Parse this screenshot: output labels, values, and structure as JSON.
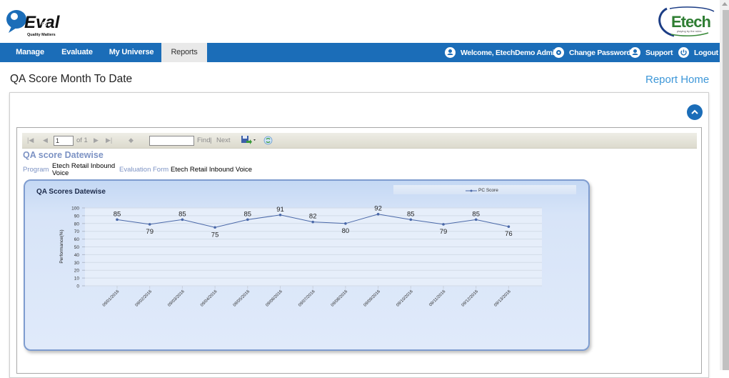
{
  "brand": {
    "logo_left": "Q-Eval",
    "logo_left_tagline": "Quality Matters",
    "logo_right": "Etech",
    "logo_right_tagline": "playing by the rules"
  },
  "nav": {
    "items": [
      {
        "label": "Manage",
        "active": false
      },
      {
        "label": "Evaluate",
        "active": false
      },
      {
        "label": "My Universe",
        "active": false
      },
      {
        "label": "Reports",
        "active": true
      }
    ],
    "right": [
      {
        "label": "Welcome, EtechDemo Admin",
        "icon": "user-icon"
      },
      {
        "label": "Change Password",
        "icon": "gear-icon"
      },
      {
        "label": "Support",
        "icon": "support-icon"
      },
      {
        "label": "Logout",
        "icon": "power-icon"
      }
    ]
  },
  "page": {
    "title": "QA Score Month To Date",
    "report_home": "Report Home"
  },
  "toolbar": {
    "page_value": "1",
    "of_label": "of 1",
    "find_value": "",
    "find_label": "Find",
    "separator": "|",
    "next_label": "Next"
  },
  "report": {
    "title": "QA score Datewise",
    "program_label": "Program",
    "program_value_line1": "Etech Retail Inbound",
    "program_value_line2": "Voice",
    "form_label": "Evaluation Form",
    "form_value": "Etech Retail Inbound Voice"
  },
  "chart_data": {
    "type": "line",
    "title": "QA Scores Datewise",
    "xlabel": "",
    "ylabel": "Performance(%)",
    "ylim": [
      0,
      100
    ],
    "yticks": [
      0,
      10,
      20,
      30,
      40,
      50,
      60,
      70,
      80,
      90,
      100
    ],
    "grid": true,
    "legend_position": "top-right",
    "categories": [
      "09/01/2016",
      "09/02/2016",
      "09/03/2016",
      "09/04/2016",
      "09/05/2016",
      "09/06/2016",
      "09/07/2016",
      "09/08/2016",
      "09/09/2016",
      "09/10/2016",
      "09/11/2016",
      "09/12/2016",
      "09/13/2016"
    ],
    "series": [
      {
        "name": "PC Score",
        "color": "#4a68a8",
        "values": [
          85,
          79,
          85,
          75,
          85,
          91,
          82,
          80,
          92,
          85,
          79,
          85,
          76
        ]
      }
    ],
    "label_positions": [
      "above",
      "below",
      "above",
      "below",
      "above",
      "above",
      "above",
      "below",
      "above",
      "above",
      "below",
      "above",
      "below"
    ]
  }
}
